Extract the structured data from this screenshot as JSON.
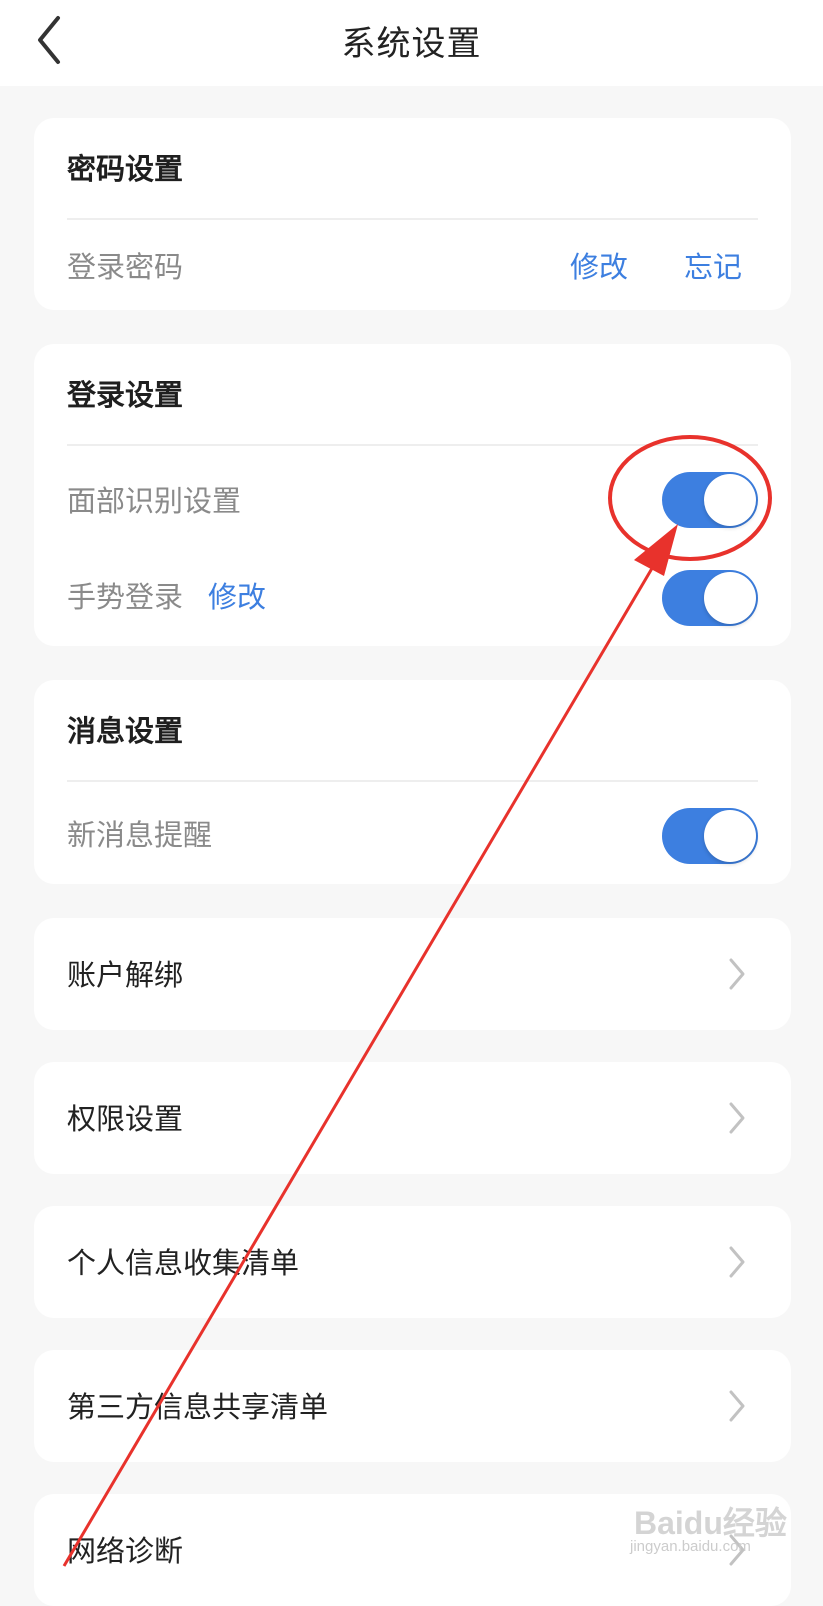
{
  "header": {
    "title": "系统设置",
    "back_icon": "chevron-left-icon"
  },
  "password_section": {
    "title": "密码设置",
    "login_password_label": "登录密码",
    "modify_label": "修改",
    "forgot_label": "忘记"
  },
  "login_section": {
    "title": "登录设置",
    "face_id_label": "面部识别设置",
    "face_id_enabled": true,
    "gesture_label": "手势登录",
    "gesture_modify_label": "修改",
    "gesture_enabled": true
  },
  "message_section": {
    "title": "消息设置",
    "new_message_label": "新消息提醒",
    "new_message_enabled": true
  },
  "nav_items": [
    {
      "label": "账户解绑",
      "icon": "chevron-right-icon"
    },
    {
      "label": "权限设置",
      "icon": "chevron-right-icon"
    },
    {
      "label": "个人信息收集清单",
      "icon": "chevron-right-icon"
    },
    {
      "label": "第三方信息共享清单",
      "icon": "chevron-right-icon"
    },
    {
      "label": "网络诊断",
      "icon": "chevron-right-icon"
    }
  ],
  "watermark": {
    "brand": "Baidu经验",
    "url": "jingyan.baidu.com"
  },
  "colors": {
    "accent": "#3d7fe0",
    "background": "#f7f7f7",
    "card": "#ffffff",
    "annotation": "#e8322c"
  }
}
